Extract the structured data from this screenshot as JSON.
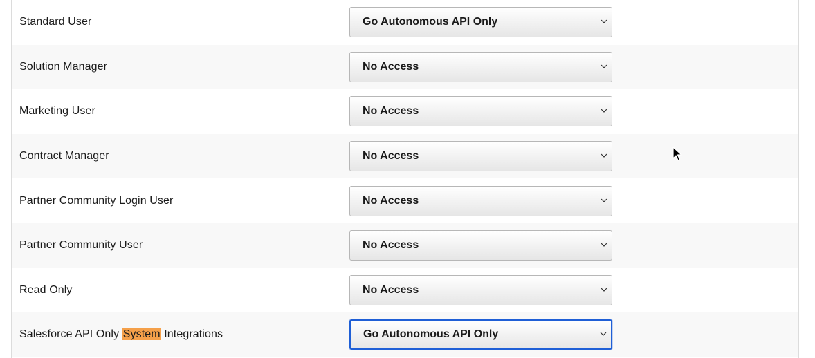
{
  "rows": [
    {
      "name": "Standard User",
      "access": "Go Autonomous API Only"
    },
    {
      "name": "Solution Manager",
      "access": "No Access"
    },
    {
      "name": "Marketing User",
      "access": "No Access"
    },
    {
      "name": "Contract Manager",
      "access": "No Access"
    },
    {
      "name": "Partner Community Login User",
      "access": "No Access"
    },
    {
      "name": "Partner Community User",
      "access": "No Access"
    },
    {
      "name": "Read Only",
      "access": "No Access"
    },
    {
      "name_before": "Salesforce API Only ",
      "name_highlight": "System",
      "name_after": " Integrations",
      "access": "Go Autonomous API Only"
    }
  ],
  "colors": {
    "highlight": "#f5a04a",
    "focus_border": "#1f5fd6",
    "alt_row": "#f8f8f8"
  },
  "icons": {
    "dropdown": "chevron-down-icon",
    "pointer": "mouse-cursor-icon"
  }
}
